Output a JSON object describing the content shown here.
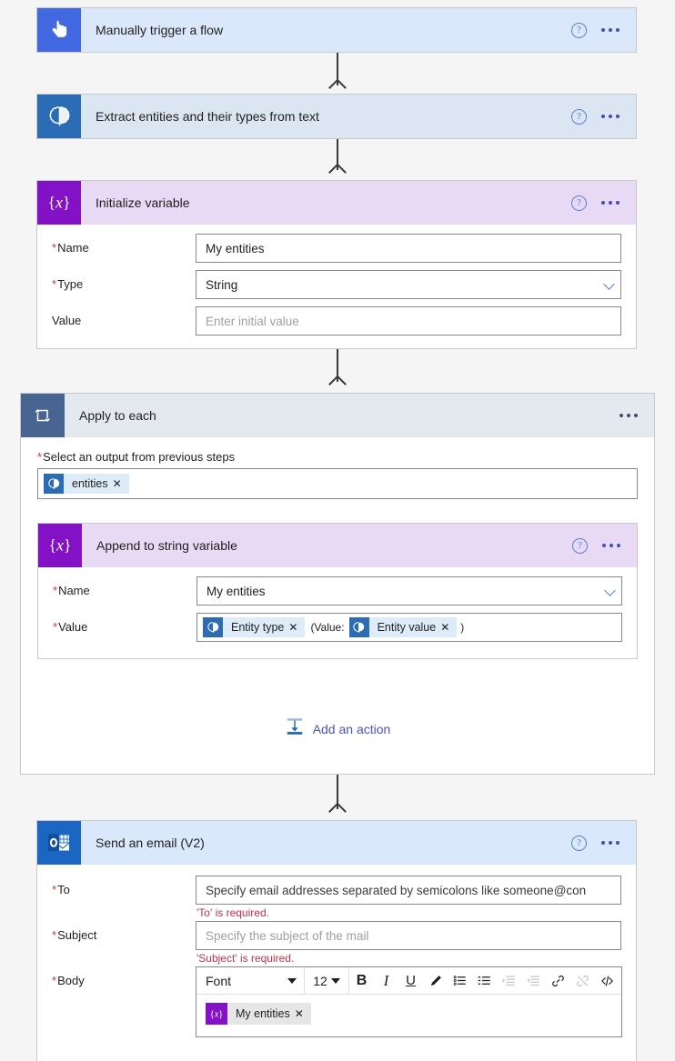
{
  "flow": {
    "steps": [
      {
        "id": "trigger",
        "title": "Manually trigger a flow",
        "icon": "hand-pointer-icon",
        "help_label": "?",
        "menu_label": "···"
      },
      {
        "id": "extract-entities",
        "title": "Extract entities and their types from text",
        "icon": "ai-builder-brain-icon",
        "help_label": "?",
        "menu_label": "···"
      },
      {
        "id": "initialize-variable",
        "title": "Initialize variable",
        "icon": "variable-braces-icon",
        "help_label": "?",
        "menu_label": "···",
        "fields": [
          {
            "label": "Name",
            "required": true,
            "value": "My entities",
            "placeholder": "",
            "control": "text"
          },
          {
            "label": "Type",
            "required": true,
            "value": "String",
            "placeholder": "",
            "control": "dropdown"
          },
          {
            "label": "Value",
            "required": false,
            "value": "",
            "placeholder": "Enter initial value",
            "control": "text"
          }
        ]
      },
      {
        "id": "apply-to-each",
        "title": "Apply to each",
        "icon": "loop-repeat-icon",
        "menu_label": "···",
        "output_label": "Select an output from previous steps",
        "output_required": true,
        "output_token": {
          "label": "entities",
          "icon": "ai-builder-brain-icon",
          "remove_label": "✕"
        },
        "add_action_label": "Add an action",
        "add_action_icon": "add-action-icon",
        "child": {
          "id": "append-to-string-variable",
          "title": "Append to string variable",
          "icon": "variable-braces-icon",
          "help_label": "?",
          "menu_label": "···",
          "fields": [
            {
              "label": "Name",
              "required": true,
              "value": "My entities",
              "control": "dropdown"
            },
            {
              "label": "Value",
              "required": true,
              "control": "tokens"
            }
          ],
          "value_tokens": [
            {
              "kind": "token",
              "label": "Entity type",
              "icon": "ai-builder-brain-icon",
              "remove_label": "✕"
            },
            {
              "kind": "text",
              "label": "(Value:"
            },
            {
              "kind": "token",
              "label": "Entity value",
              "icon": "ai-builder-brain-icon",
              "remove_label": "✕"
            },
            {
              "kind": "text",
              "label": ")"
            }
          ]
        }
      },
      {
        "id": "send-an-email",
        "title": "Send an email (V2)",
        "icon": "outlook-icon",
        "help_label": "?",
        "menu_label": "···",
        "fields": [
          {
            "label": "To",
            "required": true,
            "value": "",
            "placeholder": "Specify email addresses separated by semicolons like someone@con",
            "control": "text",
            "error": "'To' is required."
          },
          {
            "label": "Subject",
            "required": true,
            "value": "",
            "placeholder": "Specify the subject of the mail",
            "control": "text",
            "error": "'Subject' is required."
          },
          {
            "label": "Body",
            "required": true,
            "control": "richtext"
          }
        ],
        "richtext": {
          "font_label": "Font",
          "size_label": "12",
          "buttons": [
            {
              "name": "bold-button",
              "glyph": "B",
              "disabled": false
            },
            {
              "name": "italic-button",
              "glyph": "I",
              "disabled": false
            },
            {
              "name": "underline-button",
              "glyph": "U",
              "disabled": false
            },
            {
              "name": "text-color-button",
              "glyph": "pen",
              "disabled": false
            },
            {
              "name": "bulleted-list-button",
              "glyph": "ul",
              "disabled": false
            },
            {
              "name": "numbered-list-button",
              "glyph": "ol",
              "disabled": false
            },
            {
              "name": "increase-indent-button",
              "glyph": "indent",
              "disabled": true
            },
            {
              "name": "decrease-indent-button",
              "glyph": "outdent",
              "disabled": true
            },
            {
              "name": "insert-link-button",
              "glyph": "link",
              "disabled": false
            },
            {
              "name": "remove-link-button",
              "glyph": "unlink",
              "disabled": true
            },
            {
              "name": "code-view-button",
              "glyph": "code",
              "disabled": false
            }
          ],
          "body_token": {
            "label": "My entities",
            "icon": "variable-braces-icon",
            "remove_label": "✕"
          }
        }
      }
    ]
  },
  "colors": {
    "trigger_accent": "#4269e2",
    "ai_accent": "#2b6cb5",
    "variable_accent": "#8312c6",
    "loop_accent": "#486491",
    "mail_accent": "#1a66c2",
    "link": "#4b53bc",
    "error": "#c4314b",
    "canvas": "#f5f5f5"
  }
}
